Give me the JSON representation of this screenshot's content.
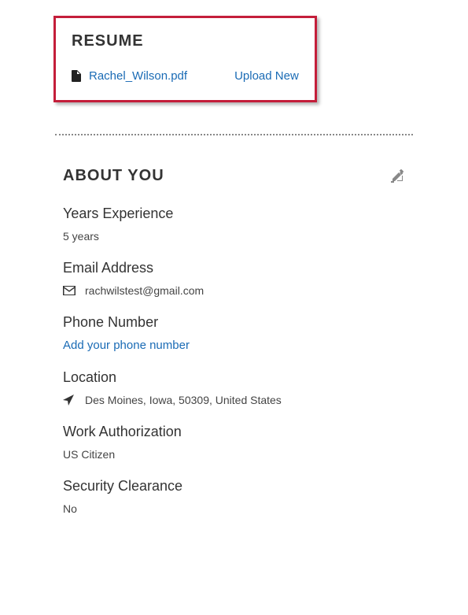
{
  "resume": {
    "heading": "RESUME",
    "file_name": "Rachel_Wilson.pdf",
    "upload_label": "Upload New"
  },
  "about": {
    "heading": "ABOUT YOU",
    "fields": {
      "years_experience": {
        "label": "Years Experience",
        "value": "5 years"
      },
      "email": {
        "label": "Email Address",
        "value": "rachwilstest@gmail.com"
      },
      "phone": {
        "label": "Phone Number",
        "placeholder_link": "Add your phone number"
      },
      "location": {
        "label": "Location",
        "value": "Des Moines, Iowa, 50309, United States"
      },
      "work_auth": {
        "label": "Work Authorization",
        "value": "US Citizen"
      },
      "security_clearance": {
        "label": "Security Clearance",
        "value": "No"
      }
    }
  }
}
